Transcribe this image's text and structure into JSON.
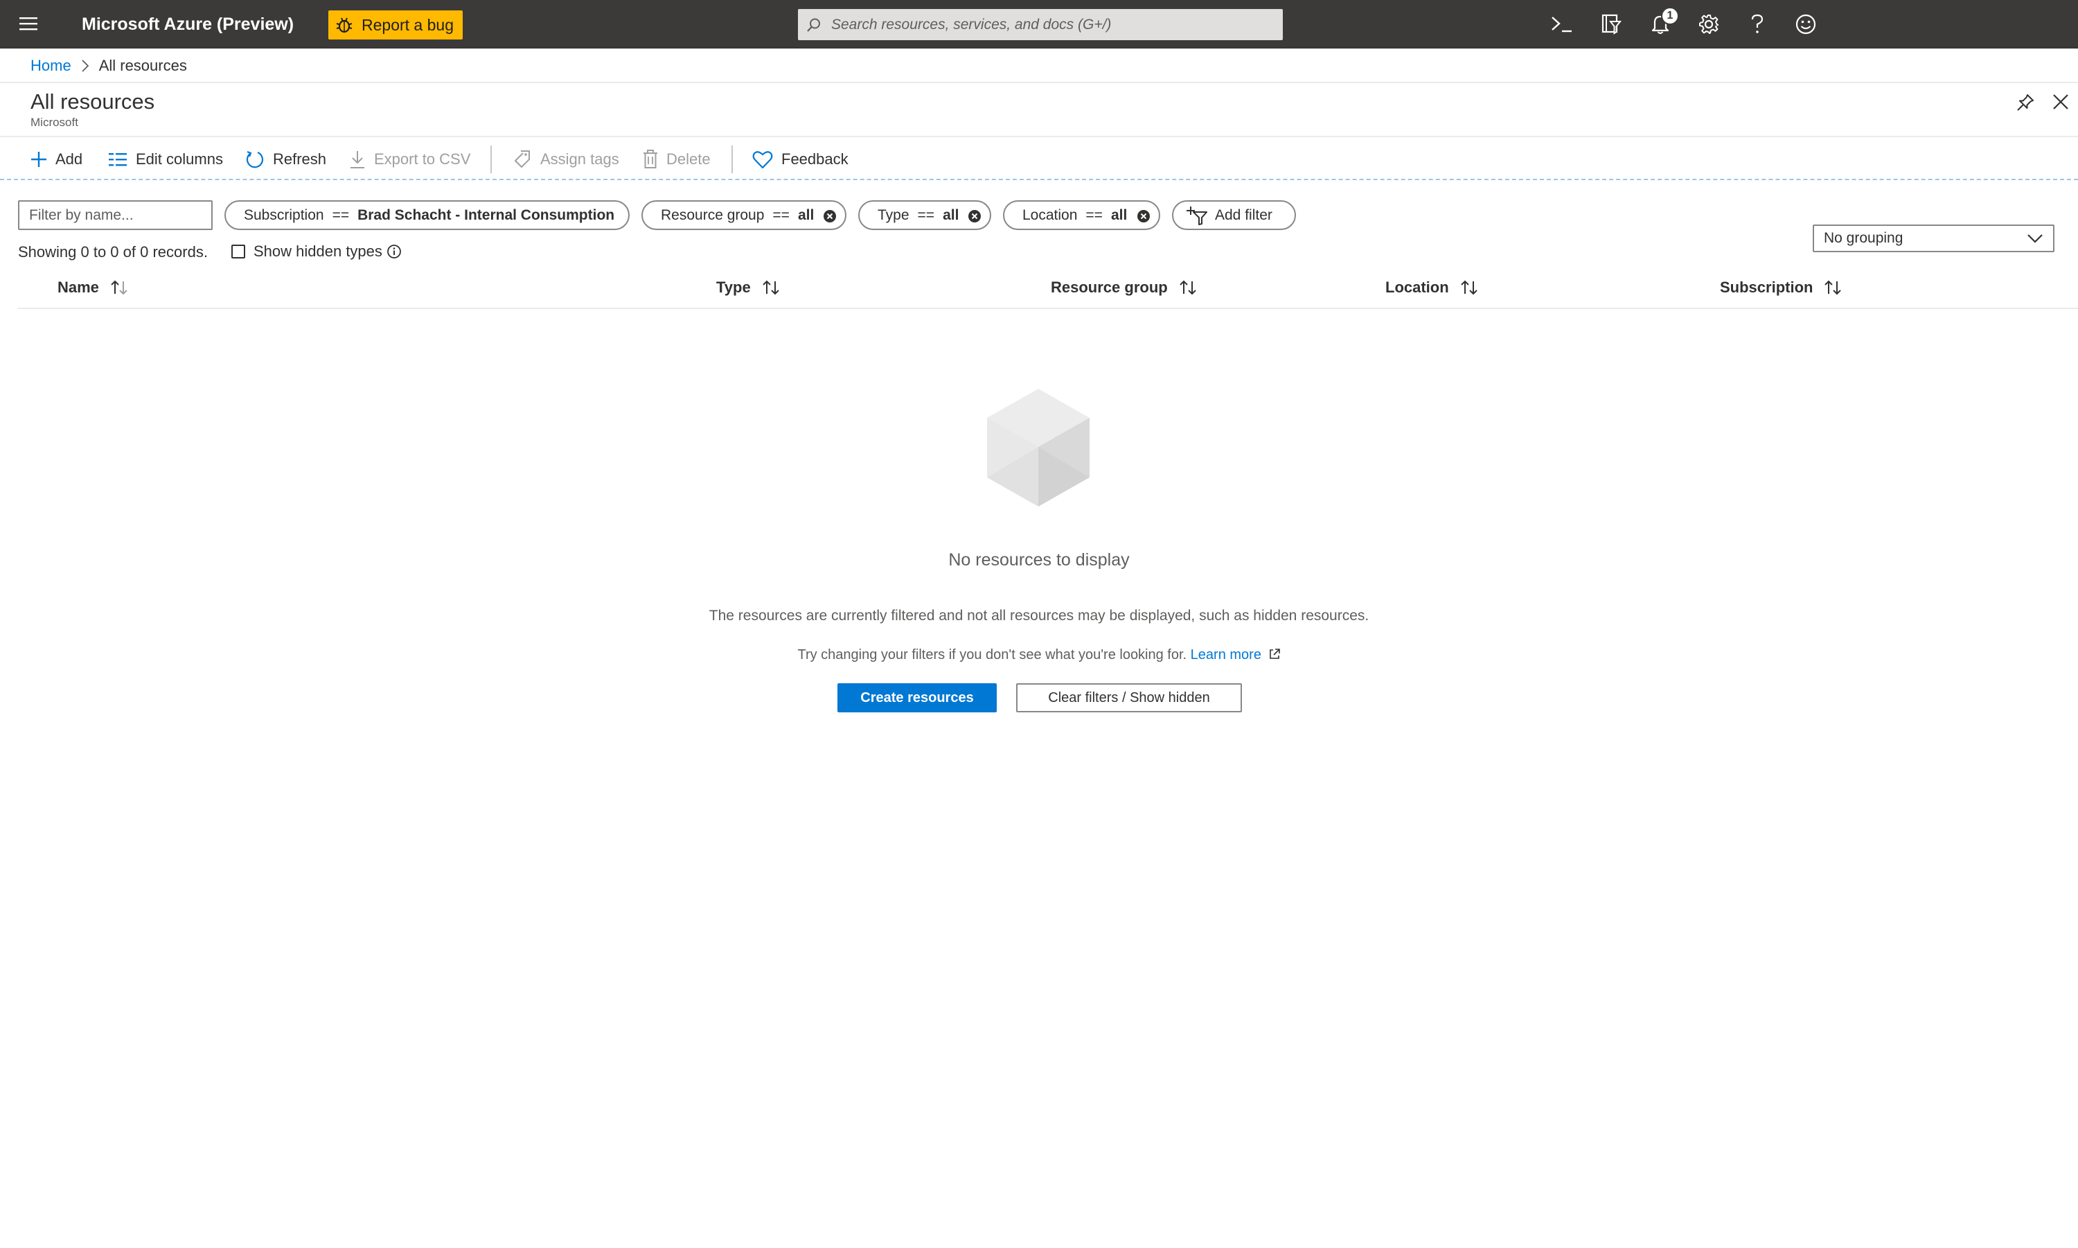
{
  "topbar": {
    "app_title": "Microsoft Azure (Preview)",
    "report_bug_label": "Report a bug",
    "search_placeholder": "Search resources, services, and docs (G+/)",
    "notification_count": "1"
  },
  "breadcrumb": {
    "home": "Home",
    "current": "All resources"
  },
  "page": {
    "title": "All resources",
    "subtitle": "Microsoft"
  },
  "commands": {
    "add": "Add",
    "edit_columns": "Edit columns",
    "refresh": "Refresh",
    "export_csv": "Export to CSV",
    "assign_tags": "Assign tags",
    "delete": "Delete",
    "feedback": "Feedback"
  },
  "filters": {
    "name_placeholder": "Filter by name...",
    "subscription": {
      "field": "Subscription",
      "op": "==",
      "value": "Brad Schacht - Internal Consumption"
    },
    "resource_group": {
      "field": "Resource group",
      "op": "==",
      "value": "all"
    },
    "type": {
      "field": "Type",
      "op": "==",
      "value": "all"
    },
    "location": {
      "field": "Location",
      "op": "==",
      "value": "all"
    },
    "add_filter": "Add filter",
    "records_text": "Showing 0 to 0 of 0 records.",
    "show_hidden_types": "Show hidden types",
    "grouping": "No grouping"
  },
  "table": {
    "columns": [
      "Name",
      "Type",
      "Resource group",
      "Location",
      "Subscription"
    ]
  },
  "empty_state": {
    "title": "No resources to display",
    "description": "The resources are currently filtered and not all resources may be displayed, such as hidden resources.",
    "hint": "Try changing your filters if you don't see what you're looking for.",
    "learn_more": "Learn more",
    "create_button": "Create resources",
    "clear_button": "Clear filters / Show hidden"
  },
  "colors": {
    "topbar_bg": "#3b3a39",
    "bug_button": "#ffb900",
    "accent": "#0078d4"
  },
  "icons": [
    "hamburger-icon",
    "bug-icon",
    "search-icon",
    "cloud-shell-icon",
    "directory-filter-icon",
    "bell-icon",
    "gear-icon",
    "help-icon",
    "smiley-icon",
    "pin-icon",
    "close-icon",
    "plus-icon",
    "columns-icon",
    "refresh-icon",
    "download-icon",
    "tag-icon",
    "trash-icon",
    "heart-icon",
    "filter-plus-icon",
    "info-icon",
    "chevron-down-icon",
    "sort-icon",
    "cube-icon",
    "external-link-icon"
  ]
}
